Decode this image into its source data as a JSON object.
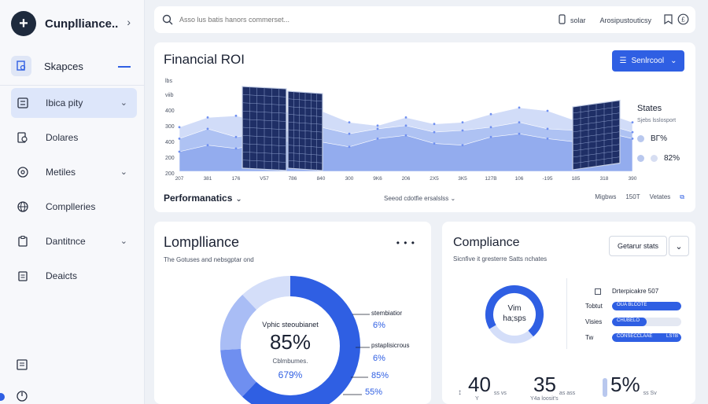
{
  "sidebar": {
    "brand": "Cunplliance..",
    "brand_logo": "+",
    "space_label": "Skapces",
    "items": [
      {
        "label": "Ibica pity",
        "icon": "checklist-icon",
        "chevron": true,
        "active": true
      },
      {
        "label": "Dolares",
        "icon": "document-search-icon",
        "chevron": false,
        "active": false
      },
      {
        "label": "Metiles",
        "icon": "settings-globe-icon",
        "chevron": true,
        "active": false
      },
      {
        "label": "Complleries",
        "icon": "globe-icon",
        "chevron": false,
        "active": false
      },
      {
        "label": "Dantitnce",
        "icon": "clipboard-icon",
        "chevron": true,
        "active": false
      },
      {
        "label": "Deaicts",
        "icon": "clipboard-list-icon",
        "chevron": false,
        "active": false
      }
    ]
  },
  "topbar": {
    "search_placeholder": "Asso lus batis hanors commerset...",
    "right_text_1": "solar",
    "right_text_2": "Arosipustouticsy"
  },
  "roi": {
    "title": "Financial ROI",
    "button_label": "Senlrcool",
    "performance_label": "Performanatics",
    "selected_label": "Seeod cdotfie ersalslss",
    "footer_right": [
      "Migbws",
      "150T",
      "Vetates"
    ],
    "states_title": "States",
    "states_sub": "Sjebs lsslosport",
    "states_rows": [
      "BΓ%",
      "82%"
    ]
  },
  "chart_data": {
    "type": "area",
    "title": "",
    "ylabel": "lbs",
    "yticks": [
      "400",
      "300",
      "400",
      "200",
      "200"
    ],
    "ytick_top": "viib",
    "xticks": [
      "207",
      "381",
      "176",
      "V57",
      "786",
      "840",
      "300",
      "9K6",
      "206",
      "2X5",
      "3K5",
      "127B",
      "106",
      "-195",
      "185",
      "318",
      "390"
    ],
    "series": [
      {
        "values": [
          270,
          330,
          340,
          300,
          380,
          370,
          300,
          280,
          330,
          290,
          300,
          350,
          390,
          370,
          310,
          360,
          300
        ]
      },
      {
        "values": [
          200,
          260,
          210,
          240,
          250,
          270,
          230,
          260,
          280,
          240,
          250,
          270,
          300,
          260,
          250,
          290,
          240
        ]
      },
      {
        "values": [
          120,
          160,
          140,
          170,
          190,
          180,
          150,
          200,
          220,
          170,
          160,
          210,
          230,
          200,
          180,
          240,
          200
        ]
      }
    ],
    "ylim": [
      0,
      500
    ]
  },
  "compliance_left": {
    "title": "Lomplliance",
    "subtitle": "The Gotuses and nebsgptar ond",
    "more": "• • •",
    "center_title": "Vphic steoubianet",
    "center_value": "85%",
    "center_sub": "Cblmbumes.",
    "center_pct": "679%",
    "legend": [
      {
        "label": "stembiatior",
        "value": "6%"
      },
      {
        "label": "pstaplisicrous",
        "value": "6%"
      },
      {
        "label": "",
        "value": "85%"
      },
      {
        "label": "",
        "value": "55%"
      }
    ],
    "donut_fractions": [
      0.62,
      0.12,
      0.14,
      0.12
    ],
    "donut_colors": [
      "#2f5fe3",
      "#6f8ff0",
      "#a9bdf5",
      "#d4def9"
    ]
  },
  "compliance_right": {
    "title": "Compliance",
    "subtitle": "Sicnfive it gresterre Satts nchates",
    "button_label": "Getarur stats",
    "ring_label_1": "Vim",
    "ring_label_2": "ha;sps",
    "ring_fraction": 0.72,
    "bar_header": "Drterpicakre 507",
    "bars": [
      {
        "name": "Tobtut",
        "text": "OUA BLCOTE",
        "text2": "",
        "fraction": 1.0
      },
      {
        "name": "Visies",
        "text": "CHUBELO",
        "text2": "",
        "fraction": 0.5
      },
      {
        "name": "Tw",
        "text": "CONSECCLAAE",
        "text2": "LSTB",
        "fraction": 1.0
      }
    ],
    "stats": [
      {
        "prefix": "↕",
        "value": "40",
        "small": "ss vs",
        "sub": "Y"
      },
      {
        "prefix": "",
        "value": "35",
        "small": "as ass",
        "sub": "Y4a loosit's"
      },
      {
        "prefix": "",
        "value": "5%",
        "small": "ss Sv",
        "sub": ""
      }
    ]
  }
}
